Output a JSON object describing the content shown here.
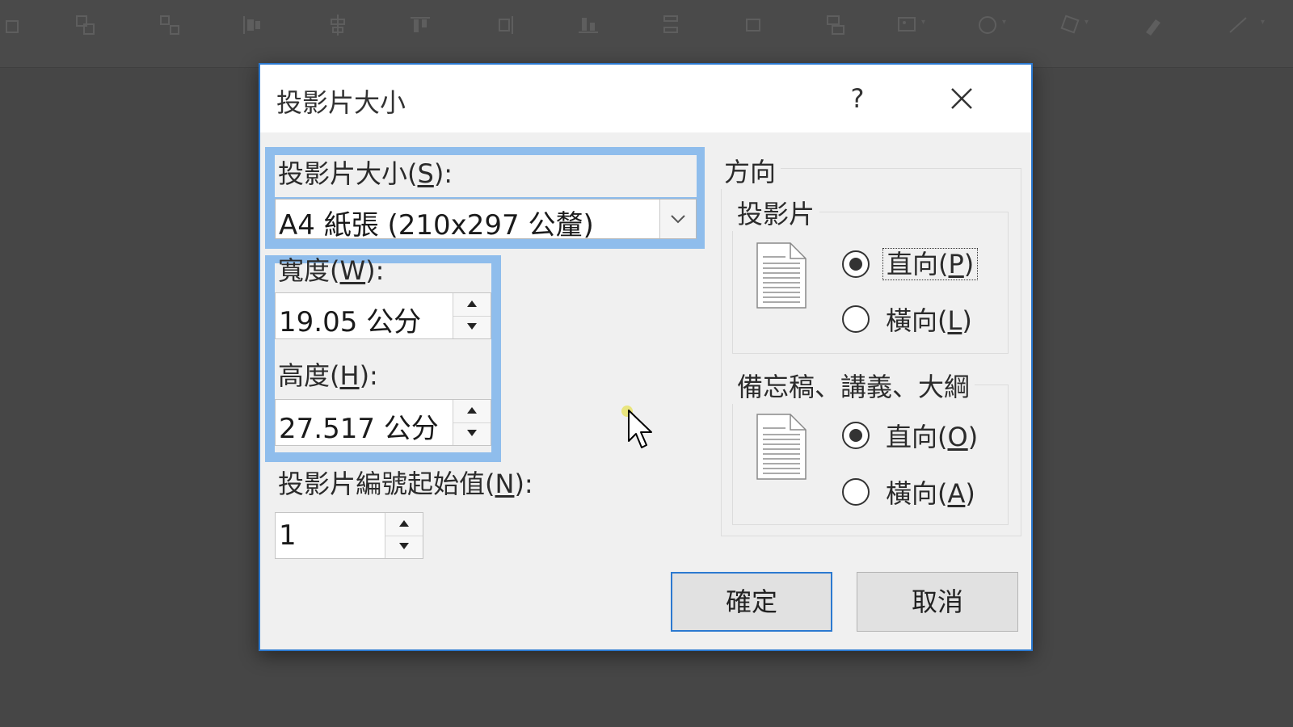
{
  "dialog": {
    "title": "投影片大小",
    "help_label": "?",
    "close_icon": "close-icon"
  },
  "slide_size": {
    "label": "投影片大小",
    "accel": "S",
    "label_suffix": "):",
    "paren": "(",
    "value": "A4 紙張 (210x297 公釐)"
  },
  "width": {
    "label": "寬度",
    "accel": "W",
    "paren": "(",
    "label_suffix": "):",
    "value": "19.05 公分"
  },
  "height": {
    "label": "高度",
    "accel": "H",
    "paren": "(",
    "label_suffix": "):",
    "value": "27.517 公分"
  },
  "numbering": {
    "label": "投影片編號起始值",
    "accel": "N",
    "paren": "(",
    "label_suffix": "):",
    "value": "1"
  },
  "orientation": {
    "title": "方向",
    "slides": {
      "title": "投影片",
      "portrait": {
        "label": "直向",
        "accel": "P",
        "paren": "(",
        "suffix": ")",
        "checked": true
      },
      "landscape": {
        "label": "橫向",
        "accel": "L",
        "paren": "(",
        "suffix": ")",
        "checked": false
      }
    },
    "notes": {
      "title": "備忘稿、講義、大綱",
      "portrait": {
        "label": "直向",
        "accel": "O",
        "paren": "(",
        "suffix": ")",
        "checked": true
      },
      "landscape": {
        "label": "橫向",
        "accel": "A",
        "paren": "(",
        "suffix": ")",
        "checked": false
      }
    }
  },
  "buttons": {
    "ok": "確定",
    "cancel": "取消"
  },
  "colors": {
    "accent": "#2b79d0",
    "highlight": "#8fbdec",
    "backdrop": "#464646"
  }
}
